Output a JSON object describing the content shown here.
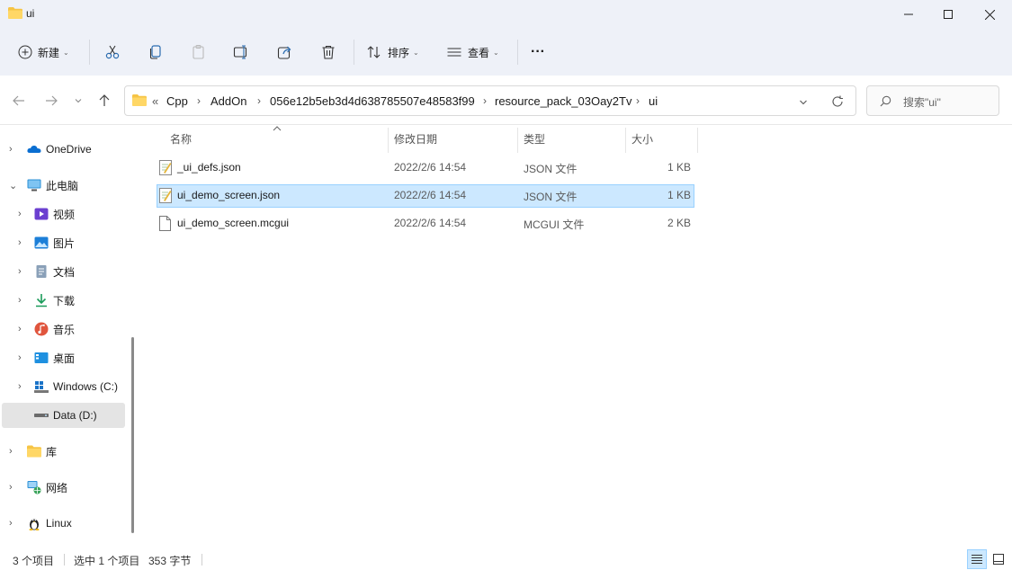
{
  "window": {
    "title": "ui"
  },
  "toolbar": {
    "new_label": "新建",
    "sort_label": "排序",
    "view_label": "查看",
    "more_label": "···"
  },
  "address": {
    "overflow": "«",
    "crumbs": [
      "Cpp",
      "AddOn",
      "056e12b5eb3d4d638785507e48583f99",
      "resource_pack_03Oay2Tv",
      "ui"
    ]
  },
  "search": {
    "placeholder": "搜索\"ui\""
  },
  "sidebar": {
    "items": [
      {
        "label": "OneDrive",
        "icon": "onedrive-icon"
      },
      {
        "label": "此电脑",
        "icon": "computer-icon"
      },
      {
        "label": "视频",
        "icon": "videos-icon"
      },
      {
        "label": "图片",
        "icon": "pictures-icon"
      },
      {
        "label": "文档",
        "icon": "documents-icon"
      },
      {
        "label": "下载",
        "icon": "downloads-icon"
      },
      {
        "label": "音乐",
        "icon": "music-icon"
      },
      {
        "label": "桌面",
        "icon": "desktop-icon"
      },
      {
        "label": "Windows (C:)",
        "icon": "drive-c-icon"
      },
      {
        "label": "Data (D:)",
        "icon": "drive-d-icon"
      },
      {
        "label": "库",
        "icon": "libraries-icon"
      },
      {
        "label": "网络",
        "icon": "network-icon"
      },
      {
        "label": "Linux",
        "icon": "linux-icon"
      }
    ]
  },
  "columns": {
    "name": "名称",
    "modified": "修改日期",
    "type": "类型",
    "size": "大小"
  },
  "files": [
    {
      "name": "_ui_defs.json",
      "modified": "2022/2/6 14:54",
      "type": "JSON 文件",
      "size": "1 KB"
    },
    {
      "name": "ui_demo_screen.json",
      "modified": "2022/2/6 14:54",
      "type": "JSON 文件",
      "size": "1 KB"
    },
    {
      "name": "ui_demo_screen.mcgui",
      "modified": "2022/2/6 14:54",
      "type": "MCGUI 文件",
      "size": "2 KB"
    }
  ],
  "status": {
    "count": "3 个项目",
    "selected": "选中 1 个项目",
    "bytes": "353 字节"
  },
  "colors": {
    "folder": "#f6c445",
    "accent": "#0067c0",
    "selection_bg": "#cce8ff"
  }
}
